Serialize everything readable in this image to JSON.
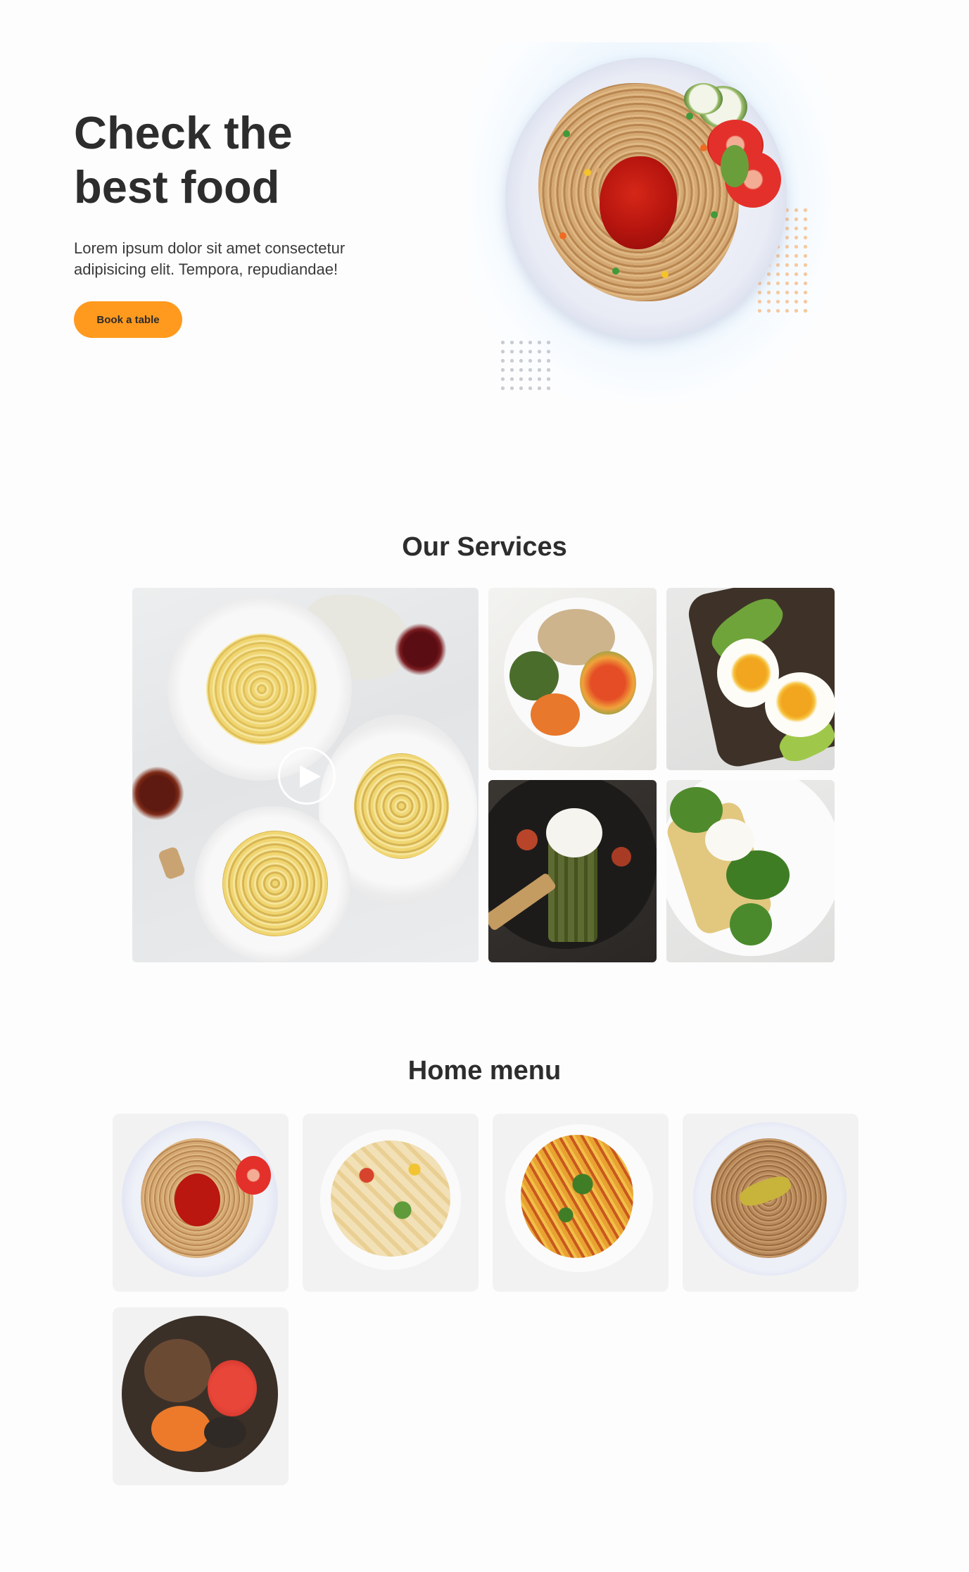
{
  "hero": {
    "title_line1": "Check the",
    "title_line2": "best food",
    "description_line1": "Lorem ipsum dolor sit amet consectetur",
    "description_line2": "adipisicing elit. Tempora, repudiandae!",
    "cta_label": "Book a table"
  },
  "services": {
    "title": "Our Services",
    "tiles": [
      {
        "icon": "pasta-dishes-photo"
      },
      {
        "icon": "vegetable-bowl-photo"
      },
      {
        "icon": "egg-avocado-toast-photo"
      },
      {
        "icon": "asparagus-plate-photo"
      },
      {
        "icon": "spinach-toast-photo"
      }
    ],
    "play_icon": "play-icon"
  },
  "home_menu": {
    "title": "Home menu",
    "items": [
      {
        "icon": "spaghetti-tomato-dish"
      },
      {
        "icon": "penne-salad-dish"
      },
      {
        "icon": "fusilli-basil-dish"
      },
      {
        "icon": "noodles-avocado-dish"
      },
      {
        "icon": "korean-bowl-dish"
      }
    ]
  },
  "colors": {
    "accent": "#ff9a1f",
    "text": "#2d2d2d",
    "card_bg": "#f2f2f2",
    "page_bg": "#fdfdfd"
  }
}
